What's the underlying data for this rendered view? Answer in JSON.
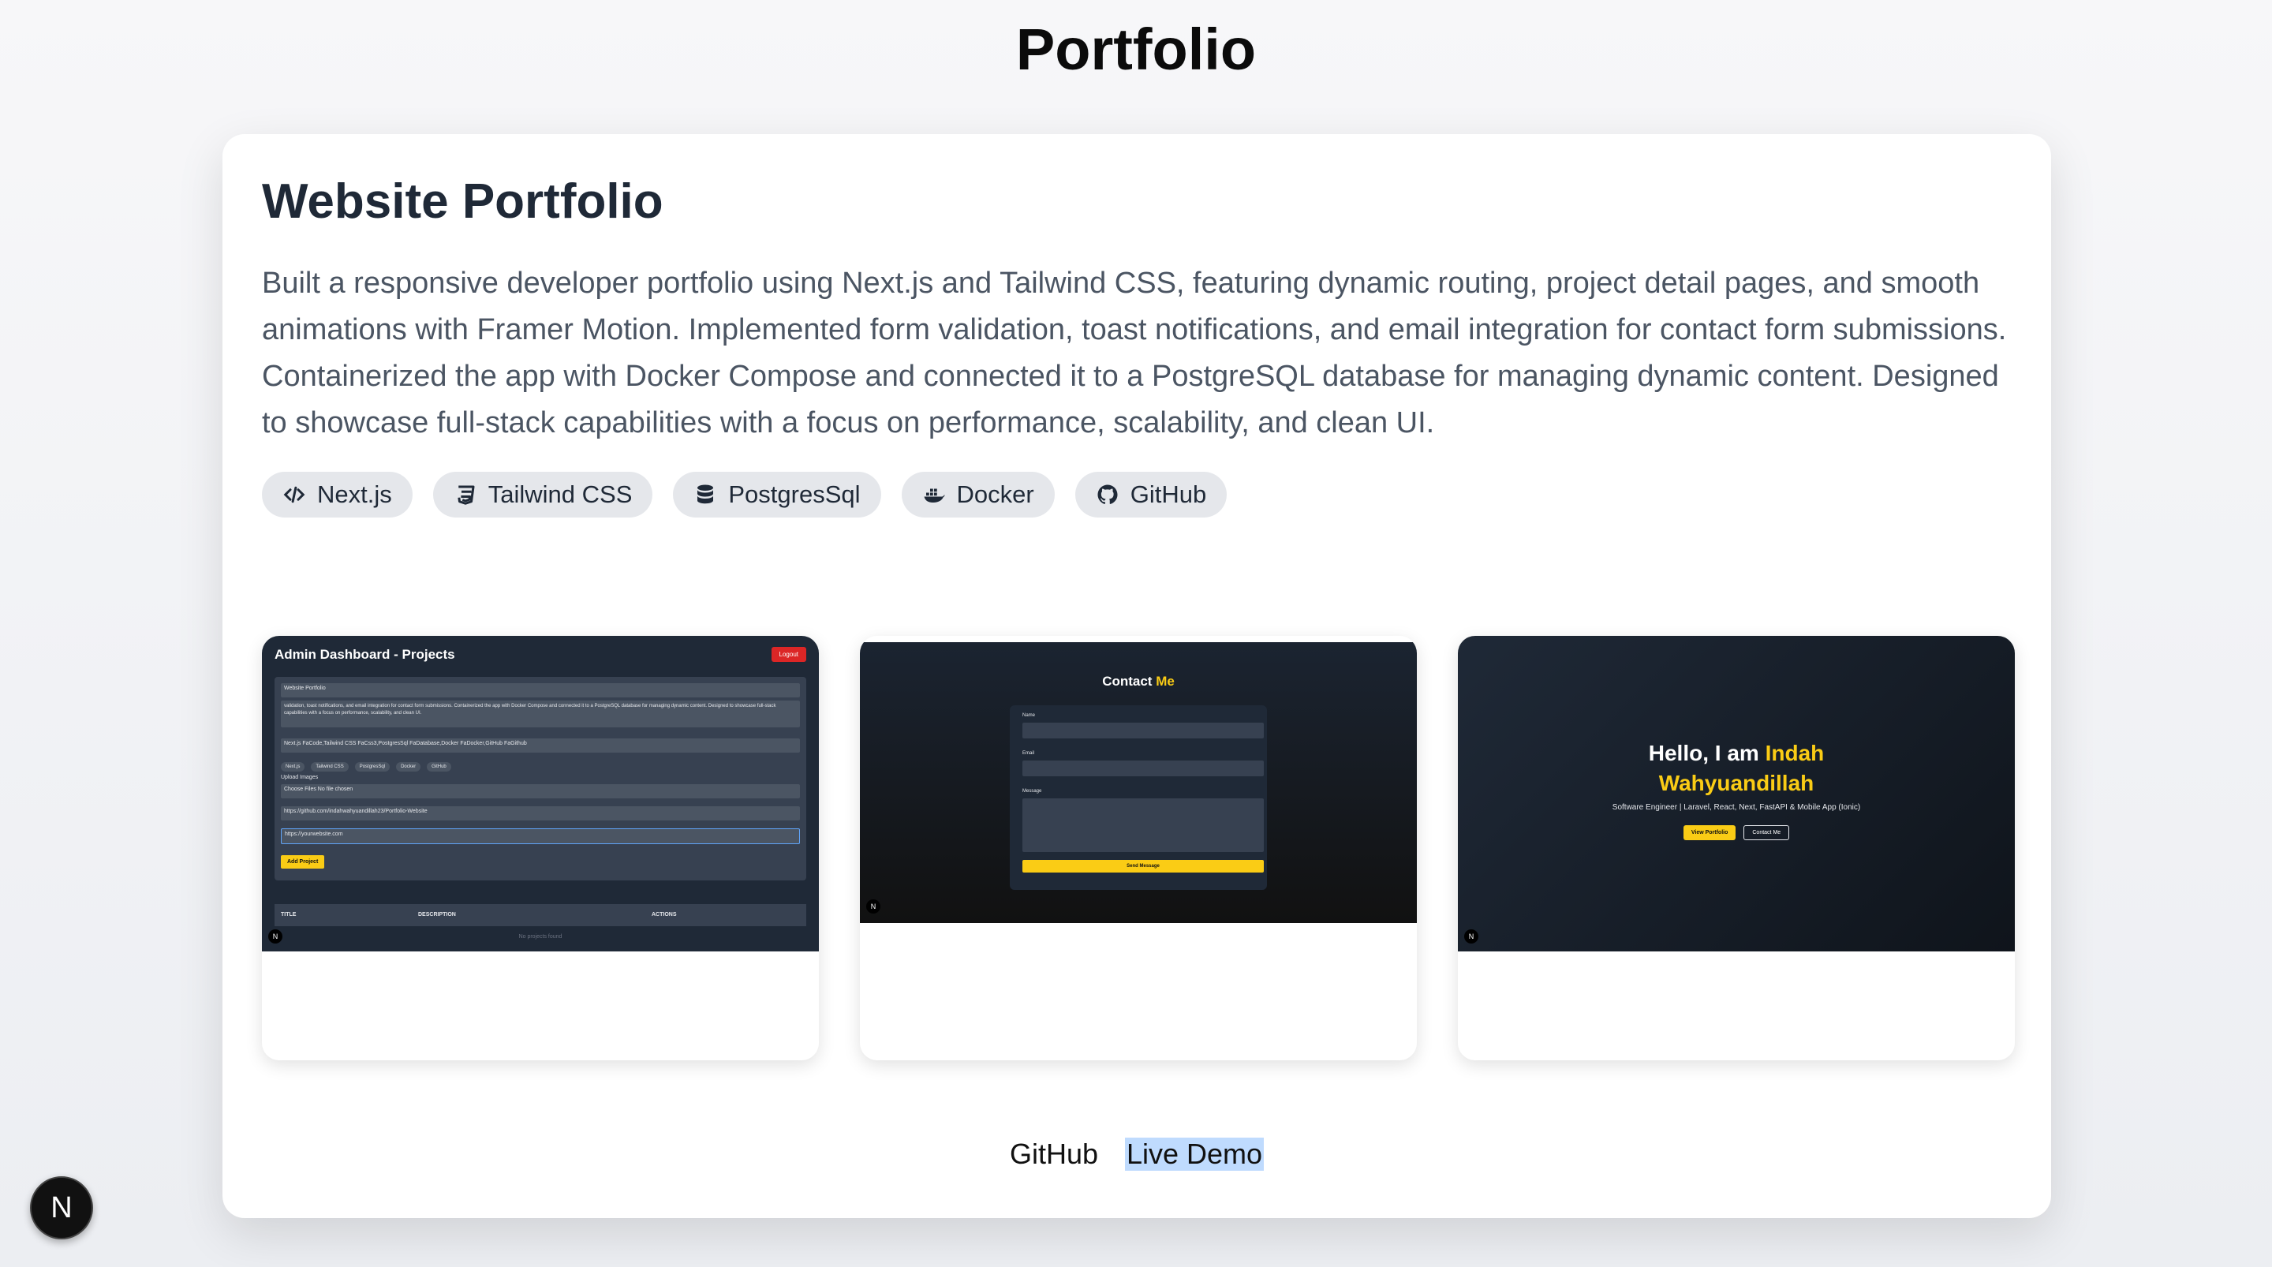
{
  "page": {
    "title": "Portfolio"
  },
  "project": {
    "title": "Website Portfolio",
    "description": "Built a responsive developer portfolio using Next.js and Tailwind CSS, featuring dynamic routing, project detail pages, and smooth animations with Framer Motion. Implemented form validation, toast notifications, and email integration for contact form submissions. Containerized the app with Docker Compose and connected it to a PostgreSQL database for managing dynamic content. Designed to showcase full-stack capabilities with a focus on performance, scalability, and clean UI.",
    "tags": [
      {
        "label": "Next.js",
        "icon": "code-icon"
      },
      {
        "label": "Tailwind CSS",
        "icon": "css-icon"
      },
      {
        "label": "PostgresSql",
        "icon": "database-icon"
      },
      {
        "label": "Docker",
        "icon": "docker-icon"
      },
      {
        "label": "GitHub",
        "icon": "github-icon"
      }
    ],
    "links": {
      "github": "GitHub",
      "live_demo": "Live Demo"
    }
  },
  "screenshots": {
    "admin": {
      "header": "Admin Dashboard - Projects",
      "logout": "Logout",
      "field_title": "Website Portfolio",
      "field_desc": "validation, toast notifications, and email integration for contact form submissions. Containerized the app with Docker Compose and connected it to a PostgreSQL database for managing dynamic content. Designed to showcase full-stack capabilities with a focus on performance, scalability, and clean UI.",
      "field_tags": "Next.js FaCode,Tailwind CSS FaCss3,PostgresSql FaDatabase,Docker FaDocker,GitHub FaGithub",
      "mini_tags": [
        "Next.js",
        "Tailwind CSS",
        "PostgresSql",
        "Docker",
        "GitHub"
      ],
      "upload_label": "Upload Images",
      "file_field": "Choose Files No file chosen",
      "github_url": "https://github.com/indahwahyuandillah23/Portfolio-Website",
      "demo_url": "https://yourwebsite.com",
      "add_button": "Add Project",
      "col_title": "TITLE",
      "col_desc": "DESCRIPTION",
      "col_actions": "ACTIONS",
      "empty": "No projects found"
    },
    "contact": {
      "title_a": "Contact ",
      "title_b": "Me",
      "name_label": "Name",
      "email_label": "Email",
      "message_label": "Message",
      "send": "Send Message"
    },
    "hero": {
      "greet": "Hello, I am ",
      "name_a": "Indah",
      "name_b": "Wahyuandillah",
      "subtitle": "Software Engineer | Laravel, React, Next, FastAPI & Mobile App (Ionic)",
      "btn_portfolio": "View Portfolio",
      "btn_contact": "Contact Me"
    }
  },
  "badge": {
    "letter": "N"
  }
}
